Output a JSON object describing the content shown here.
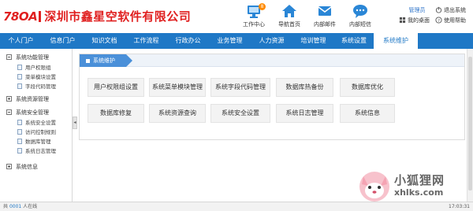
{
  "brand": {
    "logo_number": "78",
    "logo_suffix": "OA",
    "company_name": "深圳市鑫星空软件有限公司"
  },
  "top_icons": [
    {
      "label": "工作中心",
      "badge": "8",
      "icon": "monitor-icon"
    },
    {
      "label": "导航首页",
      "icon": "home-icon"
    },
    {
      "label": "内部邮件",
      "icon": "mail-icon"
    },
    {
      "label": "内部短信",
      "icon": "chat-icon"
    }
  ],
  "user_panel": {
    "role": "管理员",
    "logout": "退出系统",
    "desktop": "我的桌面",
    "help": "使用帮助"
  },
  "nav": {
    "items": [
      "个人门户",
      "信息门户",
      "知识文档",
      "工作流程",
      "行政办公",
      "业务管理",
      "人力资源",
      "培训管理",
      "系统设置",
      "系统维护"
    ],
    "active": "系统维护"
  },
  "sidebar": {
    "groups": [
      {
        "label": "系统功能管理",
        "expanded": true,
        "items": [
          "用户权限组",
          "菜单模块设置",
          "字段代码管理"
        ]
      },
      {
        "label": "系统资源管理",
        "expanded": false,
        "items": []
      },
      {
        "label": "系统安全管理",
        "expanded": true,
        "items": [
          "系统安全设置",
          "访问控制规则",
          "数据库管理",
          "系统日志管理"
        ]
      },
      {
        "label": "系统信息",
        "expanded": false,
        "items": []
      }
    ]
  },
  "content": {
    "breadcrumb": "系统维护",
    "row1": [
      "用户权限组设置",
      "系统菜单模块管理",
      "系统字段代码管理",
      "数据库热备份",
      "数据库优化"
    ],
    "row2": [
      "数据库修复",
      "系统资源查询",
      "系统安全设置",
      "系统日志管理",
      "系统信息"
    ]
  },
  "statusbar": {
    "prefix": "共",
    "count": "0001",
    "suffix": "人在线",
    "time": "17:03:31"
  },
  "watermark": {
    "title": "小狐狸网",
    "domain": "xhlks.com"
  },
  "colors": {
    "nav_bg": "#1f78c6",
    "brand_red": "#e02020",
    "crumb_blue": "#4a90d9",
    "badge_orange": "#ff8a00"
  }
}
